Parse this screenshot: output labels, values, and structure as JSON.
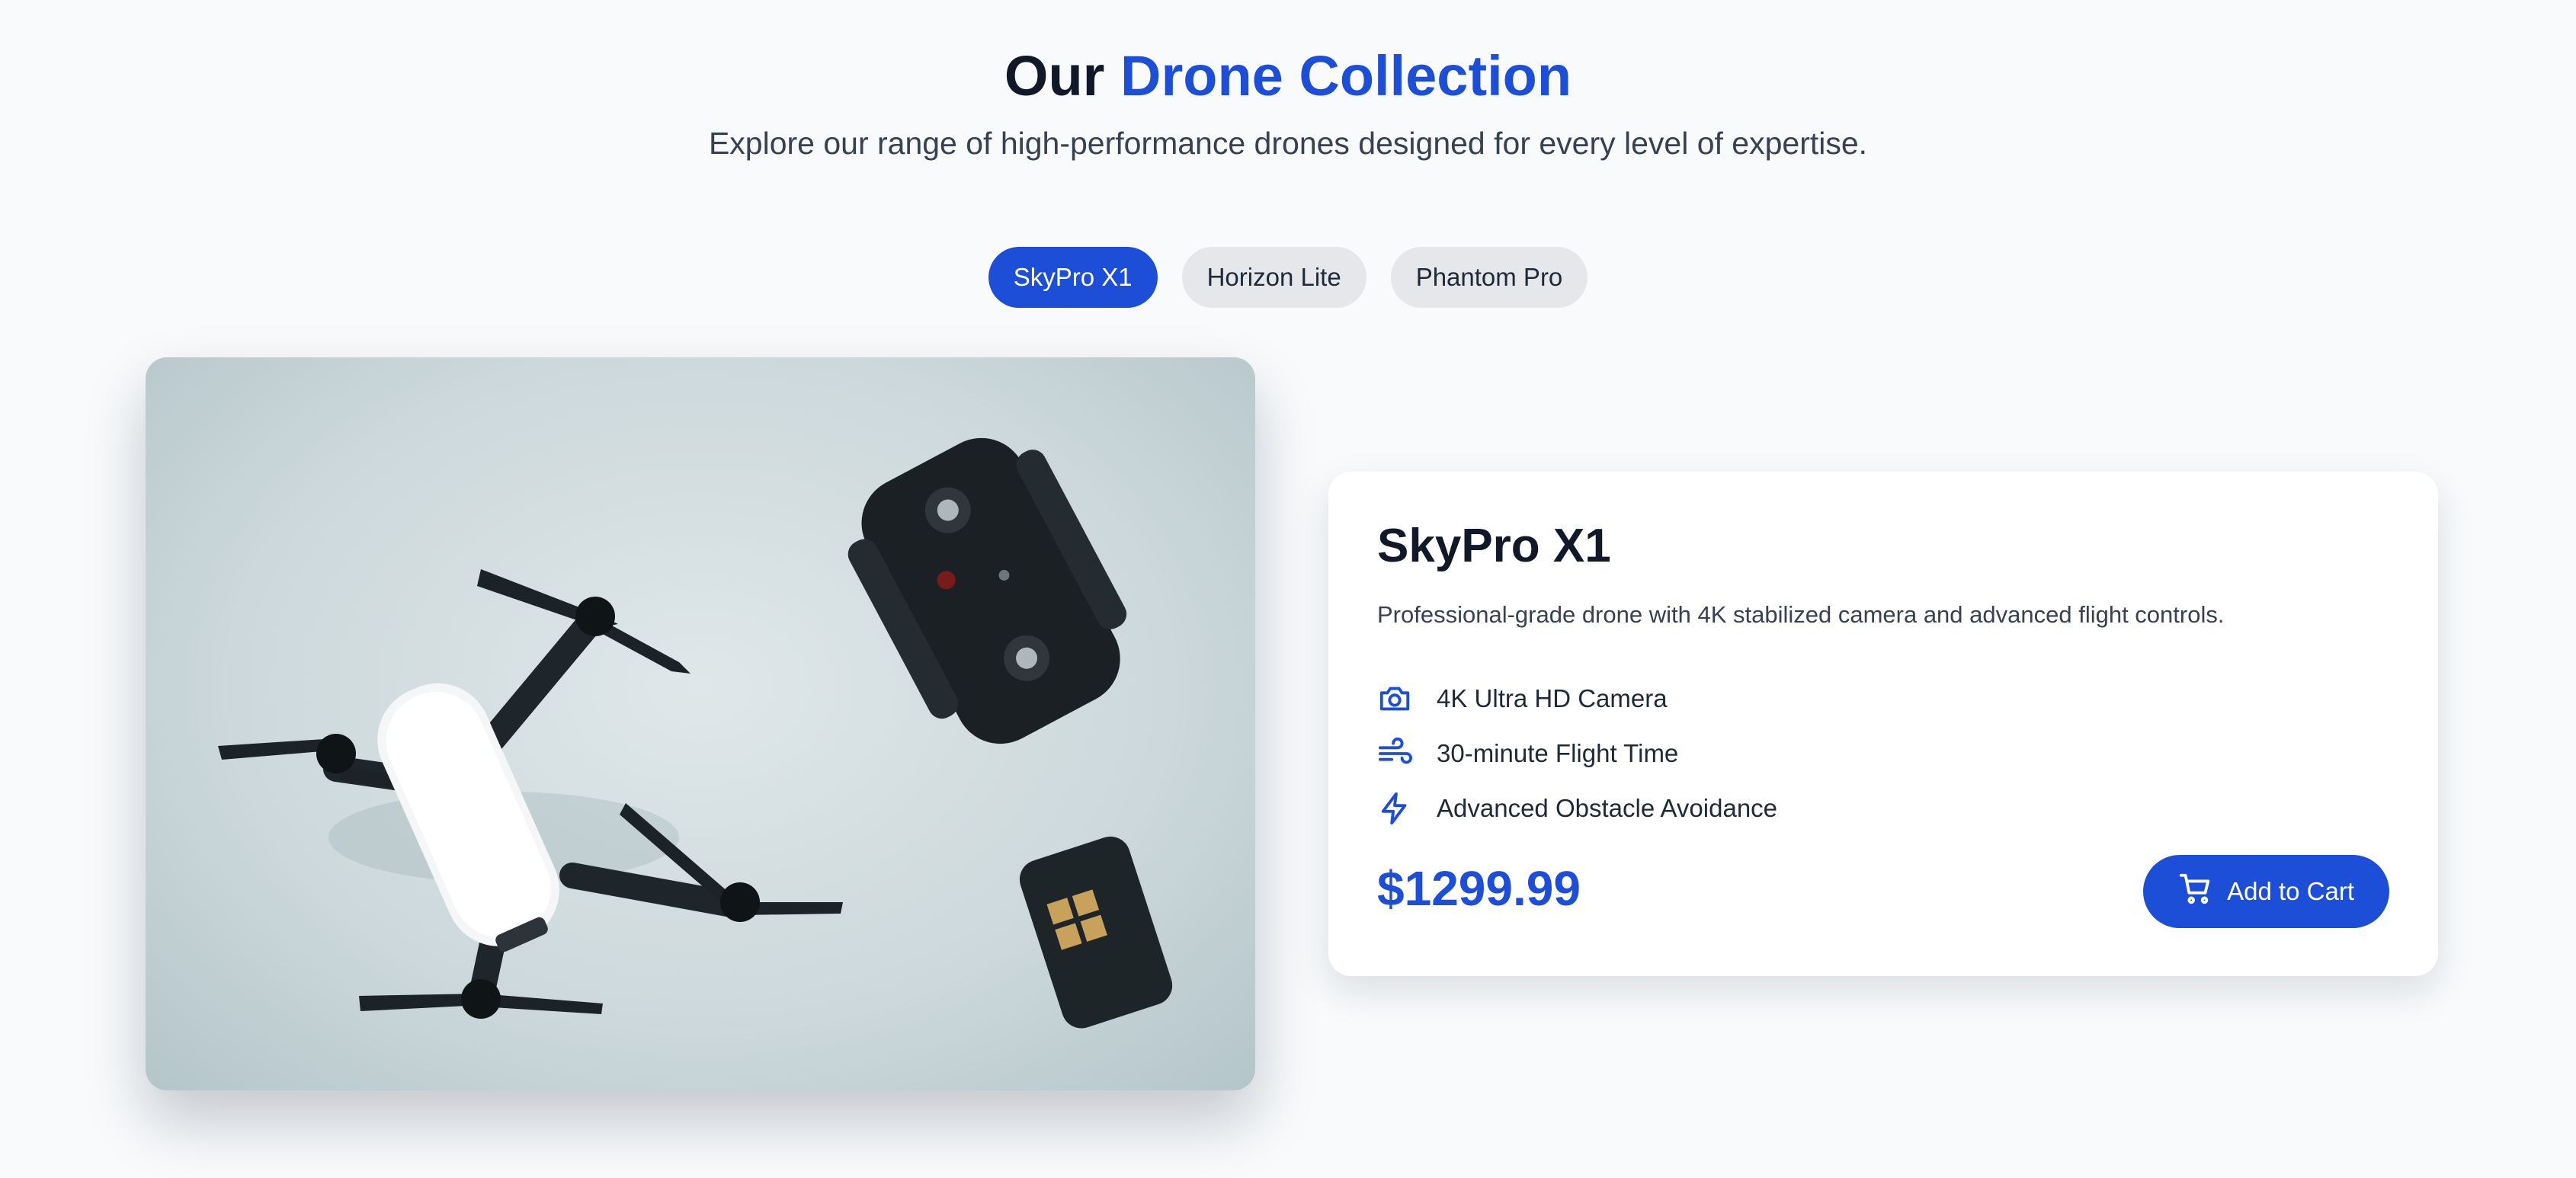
{
  "header": {
    "title_prefix": "Our",
    "title_accent": "Drone Collection",
    "subtitle": "Explore our range of high-performance drones designed for every level of expertise."
  },
  "tabs": [
    {
      "label": "SkyPro X1",
      "active": true
    },
    {
      "label": "Horizon Lite",
      "active": false
    },
    {
      "label": "Phantom Pro",
      "active": false
    }
  ],
  "product": {
    "name": "SkyPro X1",
    "description": "Professional-grade drone with 4K stabilized camera and advanced flight controls.",
    "features": [
      {
        "icon": "camera-icon",
        "label": "4K Ultra HD Camera"
      },
      {
        "icon": "wind-icon",
        "label": "30-minute Flight Time"
      },
      {
        "icon": "lightning-icon",
        "label": "Advanced Obstacle Avoidance"
      }
    ],
    "price": "$1299.99",
    "cart_button_label": "Add to Cart",
    "image_subject": "drone-with-controller-and-battery-photo"
  },
  "colors": {
    "accent": "#1d4ed8",
    "page_background": "#f8fafc",
    "tab_inactive": "#e5e7eb",
    "text_dark": "#111827"
  }
}
